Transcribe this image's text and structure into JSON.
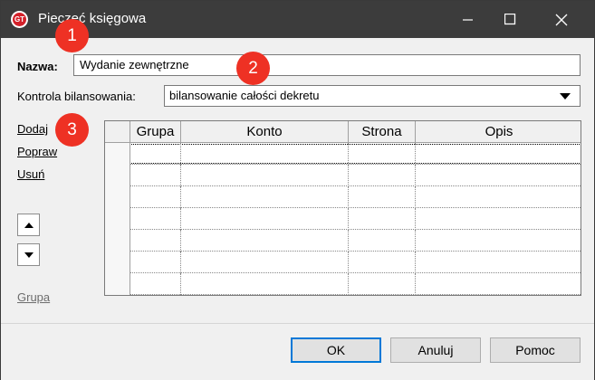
{
  "window": {
    "title": "Pieczęć księgowa",
    "app_icon": "app-logo-icon",
    "controls": [
      "minimize-icon",
      "maximize-icon",
      "close-icon"
    ]
  },
  "form": {
    "name_label": "Nazwa:",
    "name_value": "Wydanie zewnętrzne",
    "balance_label": "Kontrola bilansowania:",
    "balance_value": "bilansowanie całości dekretu"
  },
  "actions": {
    "add": "Dodaj",
    "edit": "Popraw",
    "delete": "Usuń",
    "group": "Grupa"
  },
  "grid": {
    "columns": [
      "Grupa",
      "Konto",
      "Strona",
      "Opis"
    ],
    "rows": 7
  },
  "buttons": {
    "ok": "OK",
    "cancel": "Anuluj",
    "help": "Pomoc"
  },
  "annotations": [
    "1",
    "2",
    "3"
  ],
  "colors": {
    "titlebar": "#3c3c3c",
    "annotation": "#ee3124",
    "dialog_bg": "#f0f0f0"
  }
}
